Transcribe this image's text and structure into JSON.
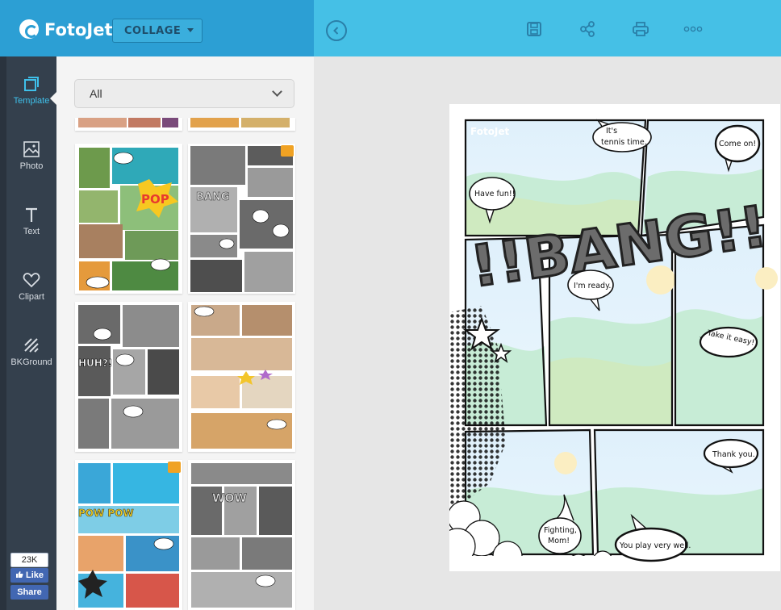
{
  "header": {
    "brand": "FotoJet",
    "mode_label": "COLLAGE",
    "icons": [
      "back-icon",
      "save-icon",
      "share-icon",
      "print-icon",
      "more-icon"
    ],
    "colors": {
      "left": "#2c9fd4",
      "right": "#45c0e6"
    }
  },
  "sidebar": {
    "items": [
      {
        "label": "Template",
        "icon": "template-icon",
        "active": true
      },
      {
        "label": "Photo",
        "icon": "photo-icon"
      },
      {
        "label": "Text",
        "icon": "text-icon"
      },
      {
        "label": "Clipart",
        "icon": "clipart-icon"
      },
      {
        "label": "BKGround",
        "icon": "background-icon"
      }
    ],
    "social": {
      "count": "23K",
      "like": "Like",
      "share": "Share"
    }
  },
  "panel": {
    "filter_value": "All",
    "thumb_texts": {
      "pop": "POP",
      "bang": "BANG",
      "huh": "HUH?!",
      "powpow": "POW POW",
      "wow": "WOW"
    }
  },
  "canvas": {
    "watermark": "FotoJet",
    "big_word": "!!BANG!!",
    "bubbles": {
      "tennis1": "It's",
      "tennis2": "tennis time.",
      "come_on": "Come on!",
      "have_fun": "Have fun!!",
      "ready": "I'm ready.",
      "easy": "Take it easy!",
      "thanks": "Thank you.",
      "fighting1": "Fighting,",
      "fighting2": "Mom!",
      "play_well": "You play very well."
    }
  }
}
